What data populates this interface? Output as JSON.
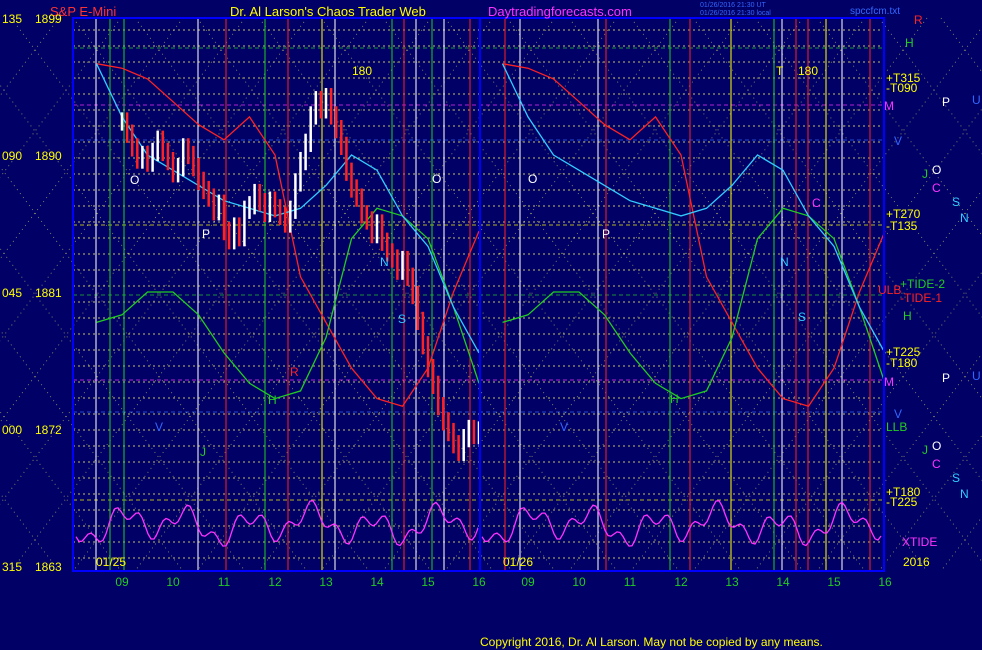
{
  "header": {
    "symbol": "S&P E-Mini",
    "title": "Dr. Al Larson's Chaos Trader Web",
    "site": "Daytradingforecasts.com",
    "file": "spccfcm.txt",
    "stamp1": "01/26/2016 21:30 UT",
    "stamp2": "01/26/2016 21:30 local"
  },
  "footer": {
    "copyright": "Copyright 2016, Dr. Al Larson. May not be copied by any means.",
    "year": "2016",
    "xtide": "XTIDE"
  },
  "colors": {
    "bg": "#000066",
    "frame": "#0000ff",
    "grid_yellow": "#ffff66",
    "white": "#ffffff",
    "red": "#ff2222",
    "green": "#22cc22",
    "cyan": "#33ccff",
    "magenta": "#ff33ff",
    "yellow_text": "#ffff00"
  },
  "chart_data": {
    "type": "line",
    "title": "Dr. Al Larson's Chaos Trader Web",
    "price_axis": {
      "ticks": [
        1899,
        1890,
        1881,
        1872,
        1863
      ],
      "ylim": [
        1863,
        1899
      ]
    },
    "angle_axis": {
      "ticks": [
        "135",
        "090",
        "045",
        "000",
        "315"
      ]
    },
    "x_axis": {
      "left_session_hours": [
        "09",
        "10",
        "11",
        "12",
        "13",
        "14",
        "15",
        "16"
      ],
      "right_session_hours": [
        "09",
        "10",
        "11",
        "12",
        "13",
        "14",
        "15",
        "16"
      ],
      "left_date": "01/25",
      "right_date": "01/26"
    },
    "series": [
      {
        "name": "S&P E-Mini",
        "kind": "bars",
        "x": [
          9.0,
          9.1,
          9.2,
          9.3,
          9.4,
          9.5,
          9.6,
          9.7,
          9.8,
          9.9,
          10.0,
          10.1,
          10.2,
          10.3,
          10.4,
          10.5,
          10.6,
          10.7,
          10.8,
          10.9,
          11.0,
          11.1,
          11.2,
          11.3,
          11.4,
          11.5,
          11.6,
          11.7,
          11.8,
          11.9,
          12.0,
          12.1,
          12.2,
          12.3,
          12.4,
          12.5,
          12.6,
          12.7,
          12.8,
          12.9,
          13.0,
          13.1,
          13.2,
          13.3,
          13.4,
          13.5,
          13.6,
          13.7,
          13.8,
          13.9,
          14.0,
          14.1,
          14.2,
          14.3,
          14.4,
          14.5,
          14.6,
          14.7,
          14.8,
          14.9,
          15.0,
          15.1,
          15.2,
          15.3,
          15.4,
          15.5,
          15.6,
          15.7,
          15.8,
          15.9,
          16.0
        ],
        "close": [
          1892.2,
          1891.4,
          1890.5,
          1889.7,
          1890.0,
          1889.5,
          1890.2,
          1891.0,
          1890.2,
          1889.6,
          1888.8,
          1889.2,
          1890.5,
          1890.0,
          1889.2,
          1888.3,
          1887.7,
          1887.2,
          1886.3,
          1886.8,
          1885.0,
          1884.4,
          1885.3,
          1884.6,
          1886.4,
          1886.7,
          1887.5,
          1886.9,
          1886.2,
          1887.0,
          1886.5,
          1886.0,
          1885.5,
          1886.4,
          1888.2,
          1889.6,
          1890.8,
          1892.6,
          1893.6,
          1893.0,
          1893.8,
          1892.6,
          1891.7,
          1890.6,
          1888.9,
          1887.8,
          1887.2,
          1886.1,
          1885.7,
          1884.8,
          1885.5,
          1884.3,
          1883.6,
          1883.2,
          1882.4,
          1883.1,
          1882.0,
          1880.8,
          1879.1,
          1877.5,
          1876.0,
          1874.9,
          1873.5,
          1872.5,
          1871.8,
          1871.0,
          1870.5,
          1871.4,
          1872.0,
          1871.6,
          1871.9
        ],
        "bull_color": "white",
        "bear_color": "red"
      },
      {
        "name": "TIDE-1",
        "kind": "flux",
        "x": [
          8.5,
          9,
          9.5,
          10,
          10.5,
          11,
          11.5,
          12,
          12.5,
          13,
          13.5,
          14,
          14.5,
          15,
          15.5,
          16
        ],
        "y": [
          1896,
          1895.7,
          1895,
          1893.5,
          1892,
          1891,
          1892.5,
          1890,
          1882,
          1879,
          1876,
          1874,
          1873.5,
          1876,
          1881,
          1885
        ]
      },
      {
        "name": "TIDE-2",
        "kind": "flux",
        "x": [
          8.5,
          9,
          9.5,
          10,
          10.5,
          11,
          11.5,
          12,
          12.5,
          13,
          13.5,
          14,
          14.5,
          15,
          15.5,
          16
        ],
        "y": [
          1879,
          1879.5,
          1881,
          1881,
          1879.5,
          1877,
          1875,
          1874,
          1874.5,
          1878,
          1884.5,
          1886.5,
          1886,
          1884.5,
          1880,
          1875
        ]
      },
      {
        "name": "Cyan flux",
        "kind": "flux",
        "x": [
          8.5,
          9,
          9.5,
          10,
          10.5,
          11,
          11.5,
          12,
          12.5,
          13,
          13.5,
          14,
          14.5,
          15,
          15.5,
          16
        ],
        "y": [
          1896,
          1892.5,
          1890,
          1889,
          1888,
          1887,
          1886.5,
          1886,
          1886.5,
          1888,
          1890,
          1889,
          1886,
          1884,
          1880,
          1877
        ]
      }
    ],
    "right_labels": [
      {
        "text": "R",
        "color": "red"
      },
      {
        "text": "H",
        "color": "green"
      },
      {
        "text": "+T315",
        "color": "yellow"
      },
      {
        "text": "-T090",
        "color": "yellow"
      },
      {
        "text": "M",
        "color": "magenta"
      },
      {
        "text": "P",
        "color": "white"
      },
      {
        "text": "U",
        "color": "blue"
      },
      {
        "text": "V",
        "color": "blue"
      },
      {
        "text": "J",
        "color": "green"
      },
      {
        "text": "O",
        "color": "white"
      },
      {
        "text": "C",
        "color": "magenta"
      },
      {
        "text": "S",
        "color": "cyan"
      },
      {
        "text": "N",
        "color": "cyan"
      },
      {
        "text": "+T270",
        "color": "yellow"
      },
      {
        "text": "-T135",
        "color": "yellow"
      },
      {
        "text": "+TIDE-2",
        "color": "green"
      },
      {
        "text": "ULB",
        "color": "red"
      },
      {
        "text": "-TIDE-1",
        "color": "red"
      },
      {
        "text": "H",
        "color": "green"
      },
      {
        "text": "+T225",
        "color": "yellow"
      },
      {
        "text": "-T180",
        "color": "yellow"
      },
      {
        "text": "M",
        "color": "magenta"
      },
      {
        "text": "P",
        "color": "white"
      },
      {
        "text": "U",
        "color": "blue"
      },
      {
        "text": "V",
        "color": "blue"
      },
      {
        "text": "LLB",
        "color": "green"
      },
      {
        "text": "J",
        "color": "green"
      },
      {
        "text": "O",
        "color": "white"
      },
      {
        "text": "C",
        "color": "magenta"
      },
      {
        "text": "S",
        "color": "cyan"
      },
      {
        "text": "N",
        "color": "cyan"
      },
      {
        "text": "+T180",
        "color": "yellow"
      },
      {
        "text": "-T225",
        "color": "yellow"
      }
    ],
    "annotations": [
      {
        "text": "180",
        "color": "yellow"
      },
      {
        "text": "T",
        "color": "yellow"
      },
      {
        "text": "180",
        "color": "yellow"
      },
      {
        "text": "O",
        "color": "white"
      },
      {
        "text": "P",
        "color": "white"
      },
      {
        "text": "N",
        "color": "cyan"
      },
      {
        "text": "S",
        "color": "cyan"
      },
      {
        "text": "H",
        "color": "green"
      },
      {
        "text": "R",
        "color": "red"
      },
      {
        "text": "J",
        "color": "green"
      },
      {
        "text": "V",
        "color": "blue"
      },
      {
        "text": "O",
        "color": "white"
      },
      {
        "text": "O",
        "color": "white"
      },
      {
        "text": "P",
        "color": "white"
      },
      {
        "text": "C",
        "color": "magenta"
      },
      {
        "text": "N",
        "color": "cyan"
      },
      {
        "text": "S",
        "color": "cyan"
      },
      {
        "text": "H",
        "color": "green"
      },
      {
        "text": "V",
        "color": "blue"
      }
    ]
  }
}
